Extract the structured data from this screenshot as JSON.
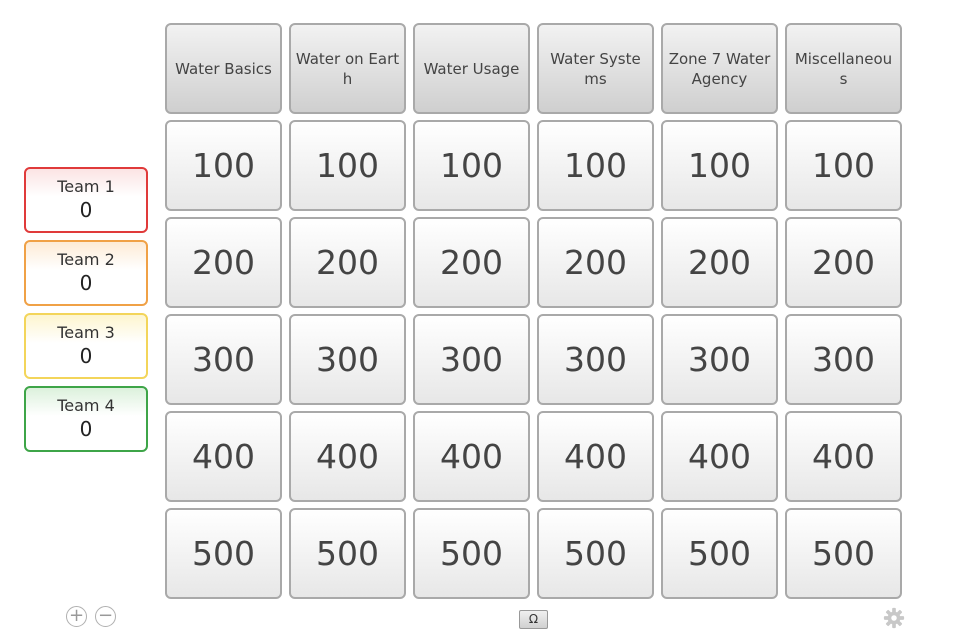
{
  "teams": [
    {
      "name": "Team 1",
      "score": "0",
      "color": "#e03a3a"
    },
    {
      "name": "Team 2",
      "score": "0",
      "color": "#f0a146"
    },
    {
      "name": "Team 3",
      "score": "0",
      "color": "#f3d55a"
    },
    {
      "name": "Team 4",
      "score": "0",
      "color": "#3ea548"
    }
  ],
  "board": {
    "categories": [
      "Water Basics",
      "Water on Earth",
      "Water Usage",
      "Water Systems",
      "Zone 7 Water Agency",
      "Miscellaneous"
    ],
    "values": [
      "100",
      "200",
      "300",
      "400",
      "500"
    ]
  },
  "controls": {
    "add_team_icon": "plus-circle-icon",
    "remove_team_icon": "minus-circle-icon",
    "special_chars_label": "Ω",
    "settings_icon": "gear-icon"
  }
}
